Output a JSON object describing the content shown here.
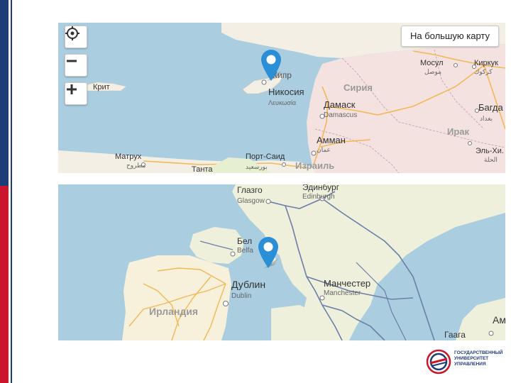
{
  "map_top": {
    "controls": {
      "locate_icon": "crosshair-icon",
      "zoom_out_icon": "minus-icon",
      "zoom_in_icon": "plus-icon"
    },
    "big_map_button": "На большую карту",
    "colors": {
      "sea": "#aacde0",
      "land": "#f4efe4",
      "land_pink": "#f4e2e0",
      "road": "#f2b857"
    },
    "labels": {
      "crete": "Крит",
      "cyprus": "Кипр",
      "nicosia": "Никосия",
      "nicosia_local": "Λευκωσία",
      "syria": "Сирия",
      "damascus": "Дамаск",
      "damascus_en": "Damascus",
      "amman": "Амман",
      "amman_ar": "عمان",
      "israel": "Израиль",
      "port_said": "Порт-Саид",
      "port_said_ar": "بورسعيد",
      "matruh": "Матрух",
      "matruh_ar": "مطروح",
      "tanta": "Танта",
      "mosul": "Мосул",
      "mosul_ar": "موصل",
      "kirkuk": "Киркук",
      "kirkuk_ar": "كركوك",
      "iraq": "Ирак",
      "baghdad": "Багда",
      "baghdad_ar": "بغداد",
      "el_hilla": "Эль-Хи.",
      "el_hilla_ar": "الحلة"
    }
  },
  "map_bottom": {
    "colors": {
      "sea": "#aacde0",
      "land": "#eef0dc",
      "ireland": "#f7f1dc",
      "road": "#f2b857",
      "rail": "#6b7fa8"
    },
    "labels": {
      "glasgow": "Глазго",
      "glasgow_en": "Glasgow",
      "edinburgh": "Эдинбург",
      "edinburgh_en": "Edinburgh",
      "belfast": "Бел",
      "belfast_en": "Belfa",
      "dublin": "Дублин",
      "dublin_en": "Dublin",
      "ireland": "Ирландия",
      "manchester": "Манчестер",
      "manchester_en": "Manchester",
      "hague": "Гаага",
      "am": "Ам"
    }
  },
  "logo": {
    "text": "ГОСУДАРСТВЕННЫЙ\nУНИВЕРСИТЕТ\nУПРАВЛЕНИЯ",
    "colors": {
      "blue": "#1d3d78",
      "red": "#c9162c"
    }
  },
  "side_bar_colors": {
    "blue": "#1d3d78",
    "red": "#c9162c"
  }
}
